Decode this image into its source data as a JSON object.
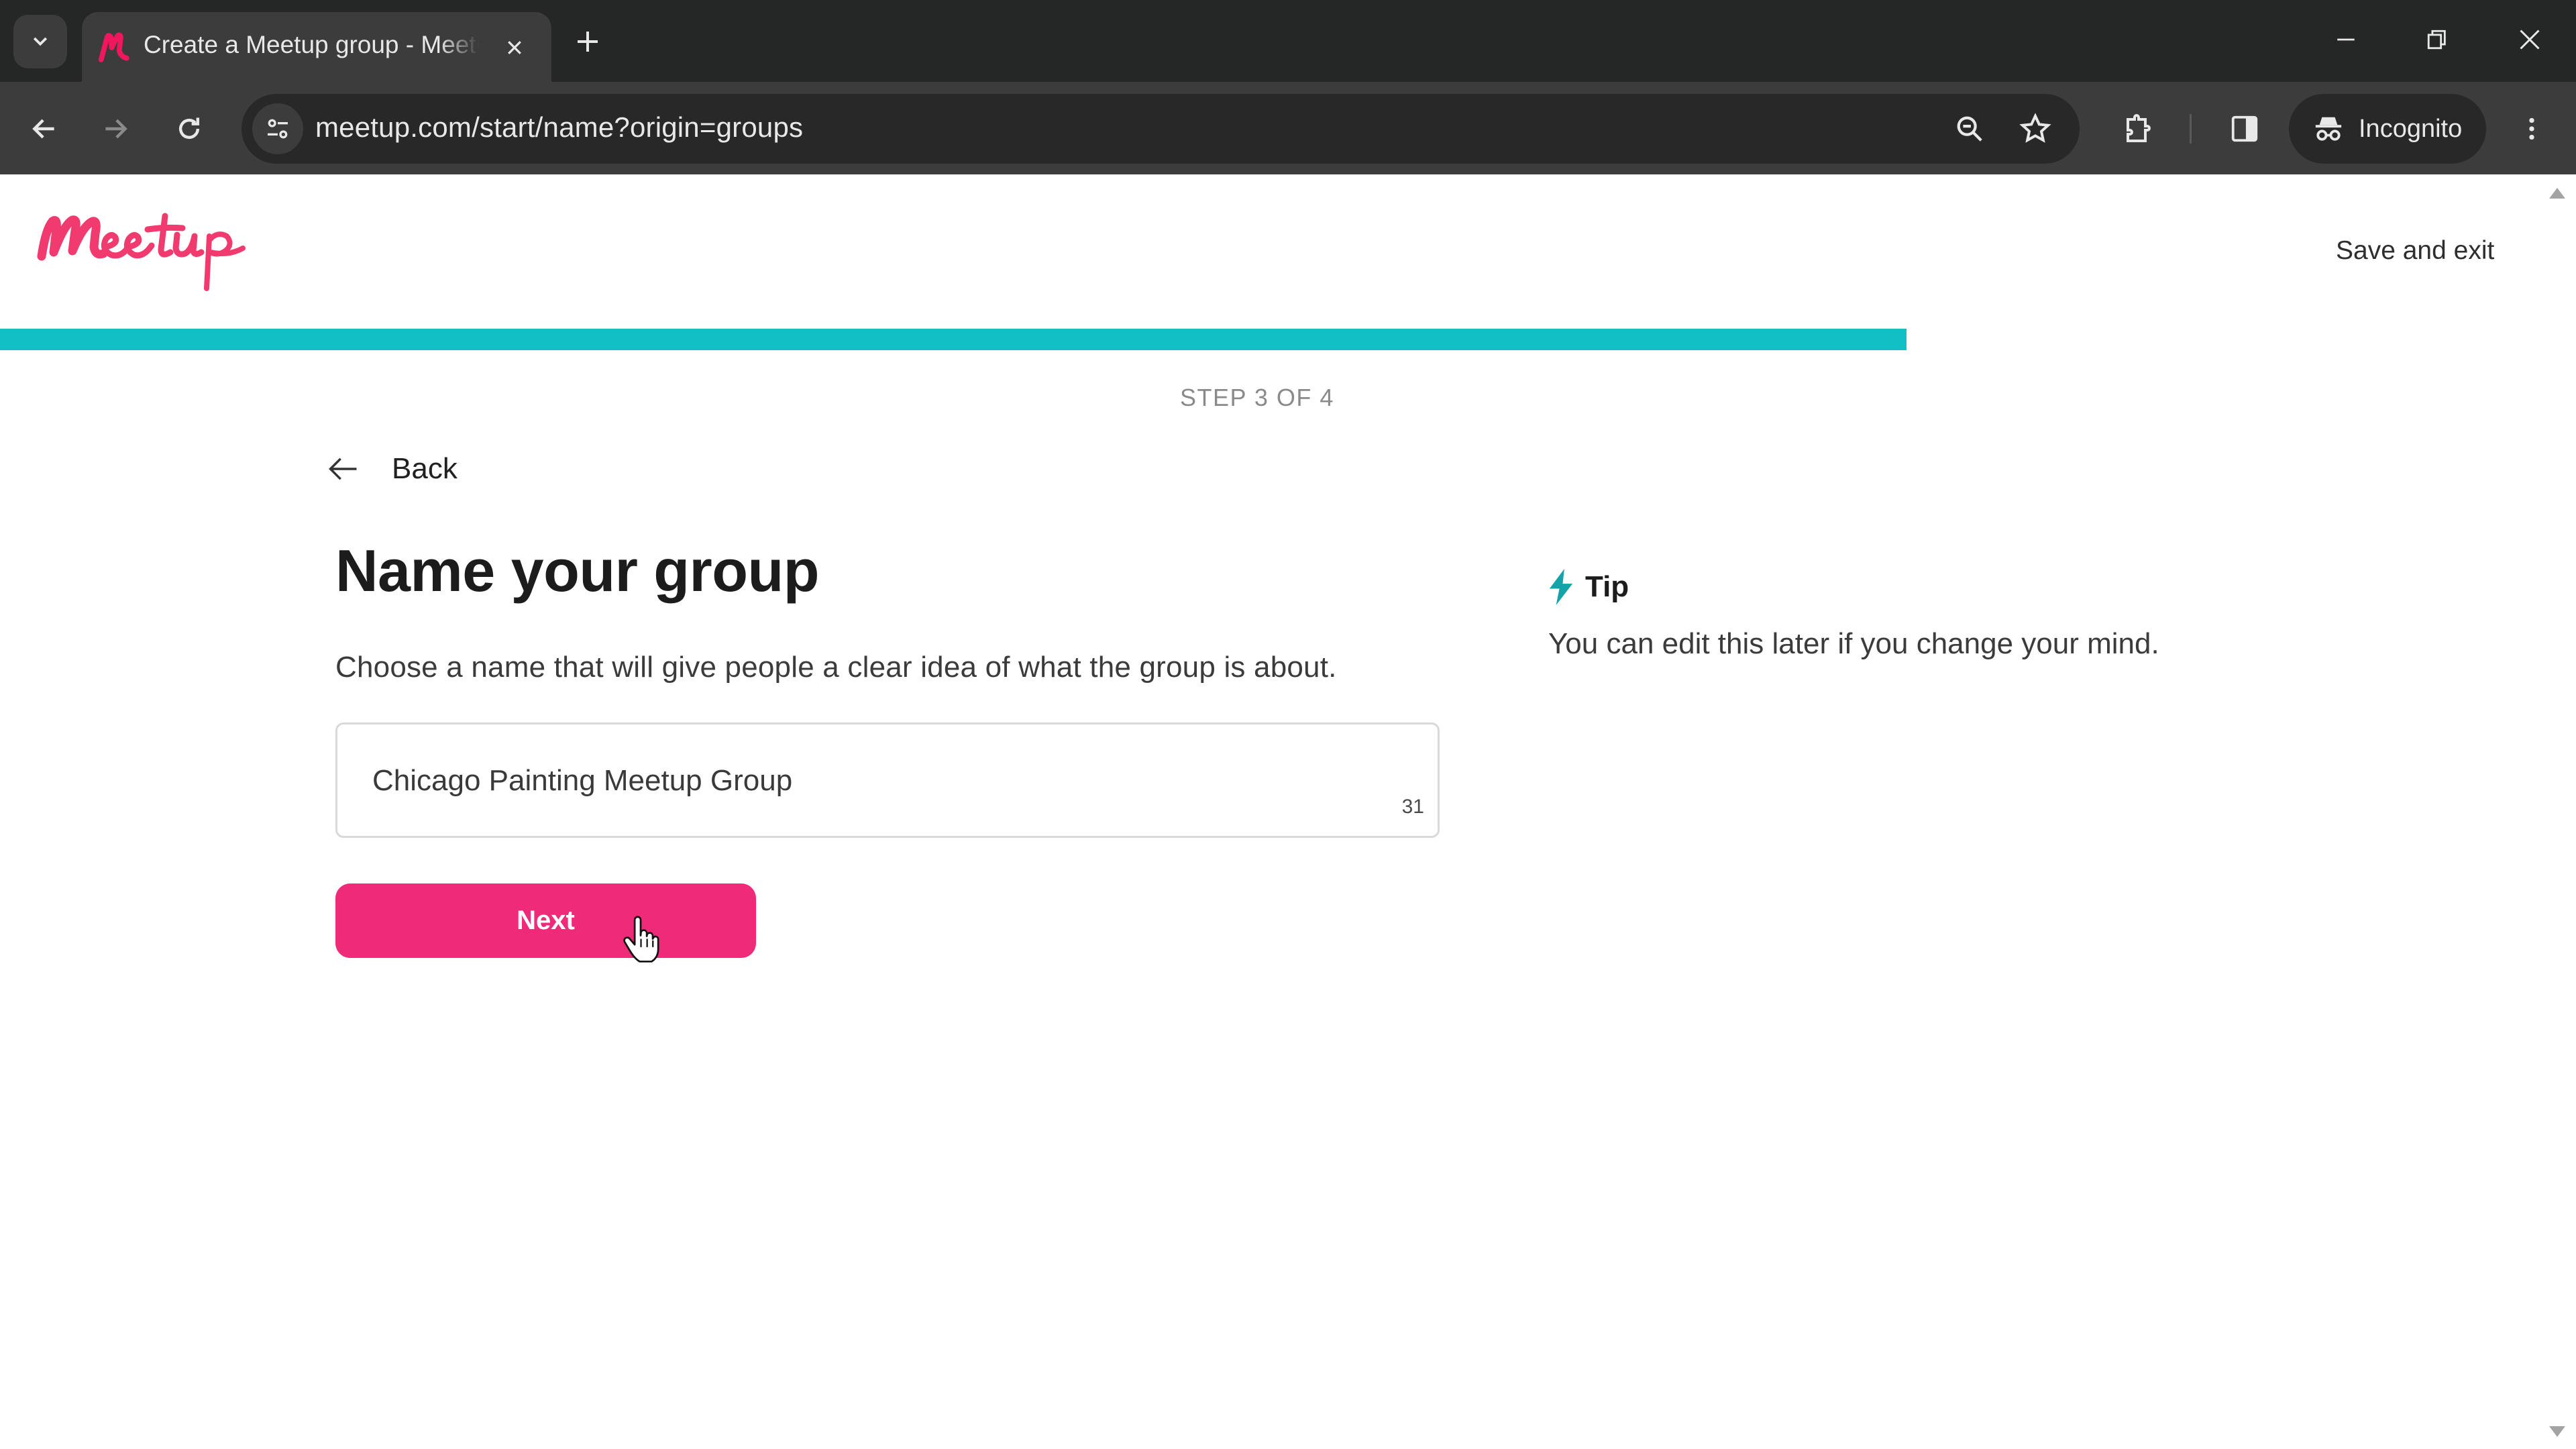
{
  "browser": {
    "tab": {
      "title": "Create a Meetup group - Meetup",
      "favicon": "meetup-m-icon"
    },
    "url": "meetup.com/start/name?origin=groups",
    "incognito_label": "Incognito",
    "icons": {
      "tab_search": "chevron-down-icon",
      "tab_close": "close-icon",
      "new_tab": "plus-icon",
      "minimize": "minimize-icon",
      "restore": "restore-icon",
      "window_close": "close-icon",
      "back": "arrow-left-icon",
      "forward": "arrow-right-icon",
      "reload": "reload-icon",
      "site_info": "tune-icon",
      "zoom": "zoom-out-icon",
      "bookmark": "star-icon",
      "extensions": "puzzle-icon",
      "side_panel": "side-panel-icon",
      "incognito": "incognito-icon",
      "menu": "kebab-menu-icon"
    }
  },
  "header": {
    "logo_alt": "Meetup",
    "save_exit_label": "Save and exit"
  },
  "progress": {
    "fraction": 0.74,
    "step_label": "STEP 3 OF 4",
    "current_step": 3,
    "total_steps": 4
  },
  "form": {
    "back_label": "Back",
    "heading": "Name your group",
    "description": "Choose a name that will give people a clear idea of what the group is about.",
    "name_value": "Chicago Painting Meetup Group",
    "char_count": "31",
    "next_label": "Next"
  },
  "tip": {
    "title": "Tip",
    "body": "You can edit this later if you change your mind."
  },
  "colors": {
    "brand_pink": "#ef2a79",
    "progress_teal": "#12bfc5",
    "tip_icon_teal": "#14a3a8",
    "chrome_dark": "#252726",
    "chrome_toolbar": "#3c3c3c"
  }
}
